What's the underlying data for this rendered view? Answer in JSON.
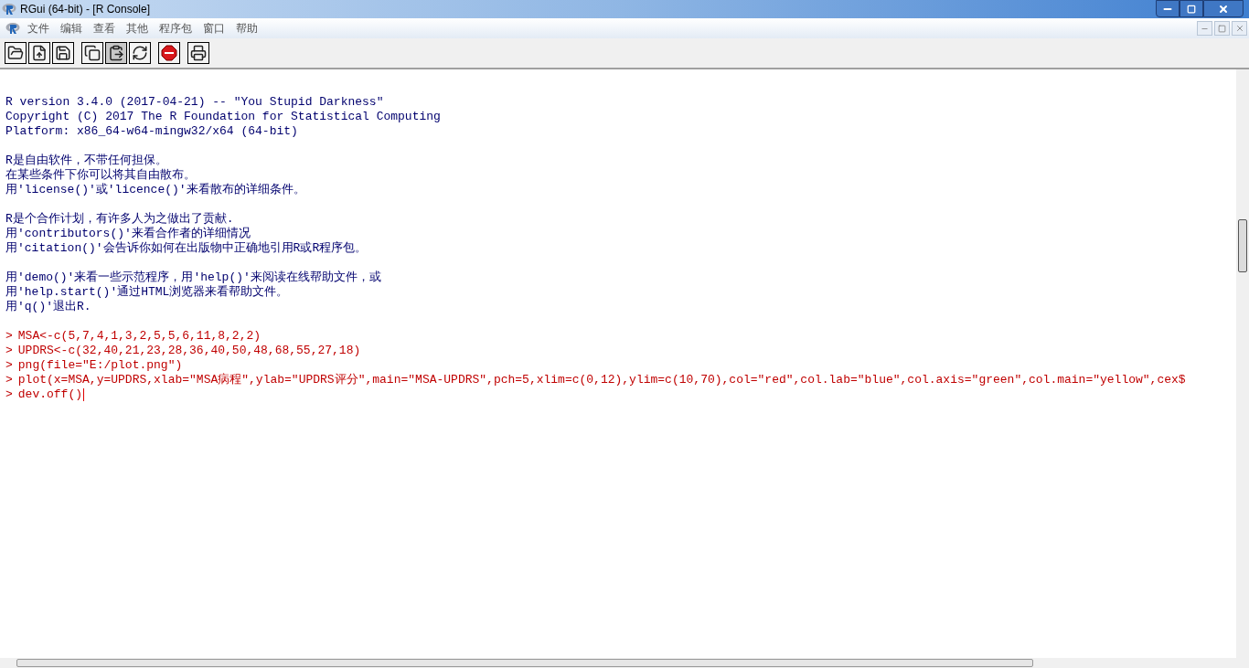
{
  "window": {
    "title": "RGui (64-bit) - [R Console]"
  },
  "menu": [
    "文件",
    "编辑",
    "查看",
    "其他",
    "程序包",
    "窗口",
    "帮助"
  ],
  "toolbar": [
    {
      "kind": "open",
      "pressed": false
    },
    {
      "kind": "load",
      "pressed": false
    },
    {
      "kind": "save",
      "pressed": false
    },
    {
      "kind": "copy",
      "pressed": false
    },
    {
      "kind": "paste",
      "pressed": true
    },
    {
      "kind": "refresh",
      "pressed": false
    },
    {
      "kind": "stop",
      "pressed": false
    },
    {
      "kind": "print",
      "pressed": false
    }
  ],
  "console": {
    "paragraphs": [
      [
        "R version 3.4.0 (2017-04-21) -- \"You Stupid Darkness\"",
        "Copyright (C) 2017 The R Foundation for Statistical Computing",
        "Platform: x86_64-w64-mingw32/x64 (64-bit)"
      ],
      [
        "R是自由软件，不带任何担保。",
        "在某些条件下你可以将其自由散布。",
        "用'license()'或'licence()'来看散布的详细条件。"
      ],
      [
        "R是个合作计划，有许多人为之做出了贡献.",
        "用'contributors()'来看合作者的详细情况",
        "用'citation()'会告诉你如何在出版物中正确地引用R或R程序包。"
      ],
      [
        "用'demo()'来看一些示范程序，用'help()'来阅读在线帮助文件，或",
        "用'help.start()'通过HTML浏览器来看帮助文件。",
        "用'q()'退出R."
      ]
    ],
    "commands": [
      {
        "prompt": ">",
        "text": "MSA<-c(5,7,4,1,3,2,5,5,6,11,8,2,2)",
        "cursor": false
      },
      {
        "prompt": ">",
        "text": "UPDRS<-c(32,40,21,23,28,36,40,50,48,68,55,27,18)",
        "cursor": false
      },
      {
        "prompt": ">",
        "text": "png(file=\"E:/plot.png\")",
        "cursor": false
      },
      {
        "prompt": ">",
        "text": "plot(x=MSA,y=UPDRS,xlab=\"MSA病程\",ylab=\"UPDRS评分\",main=\"MSA-UPDRS\",pch=5,xlim=c(0,12),ylim=c(10,70),col=\"red\",col.lab=\"blue\",col.axis=\"green\",col.main=\"yellow\",cex$",
        "cursor": false
      },
      {
        "prompt": ">",
        "text": "dev.off()",
        "cursor": true
      }
    ]
  }
}
